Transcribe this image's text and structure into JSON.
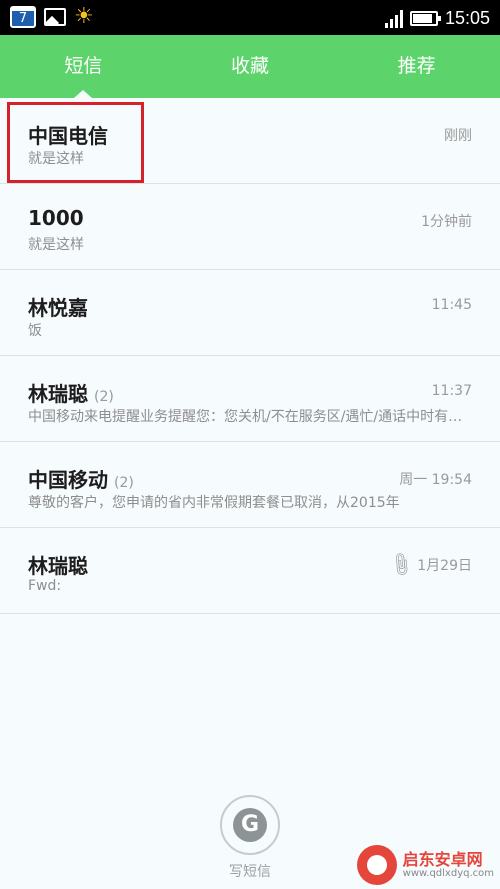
{
  "status_bar": {
    "calendar_day": "7",
    "time": "15:05",
    "icons": [
      "calendar-icon",
      "image-icon",
      "sun-icon",
      "signal-icon",
      "battery-icon"
    ]
  },
  "tabs": [
    {
      "label": "短信",
      "active": true
    },
    {
      "label": "收藏",
      "active": false
    },
    {
      "label": "推荐",
      "active": false
    }
  ],
  "messages": [
    {
      "name": "中国电信",
      "count": "",
      "preview": "就是这样",
      "time": "刚刚",
      "attachment": false
    },
    {
      "name": "1000",
      "count": "",
      "preview": "就是这样",
      "time": "1分钟前",
      "attachment": false
    },
    {
      "name": "林悦嘉",
      "count": "",
      "preview": "饭",
      "time": "11:45",
      "attachment": false
    },
    {
      "name": "林瑞聪",
      "count": "(2)",
      "preview": "中国移动来电提醒业务提醒您：您关机/不在服务区/遇忙/通话中时有来电",
      "time": "11:37",
      "attachment": false
    },
    {
      "name": "中国移动",
      "count": "(2)",
      "preview": "尊敬的客户，您申请的省内非常假期套餐已取消，从2015年",
      "time": "周一 19:54",
      "attachment": true
    },
    {
      "name": "林瑞聪",
      "count": "",
      "preview": "Fwd:",
      "time": "1月29日",
      "attachment": true
    }
  ],
  "compose": {
    "label": "写短信",
    "icon": "compose-icon"
  },
  "watermark": {
    "text": "启东安卓网",
    "url": "www.qdlxdyq.com"
  },
  "colors": {
    "tab_bar": "#5cd46b",
    "highlight": "#d6202a",
    "background": "#f6fbfd"
  }
}
